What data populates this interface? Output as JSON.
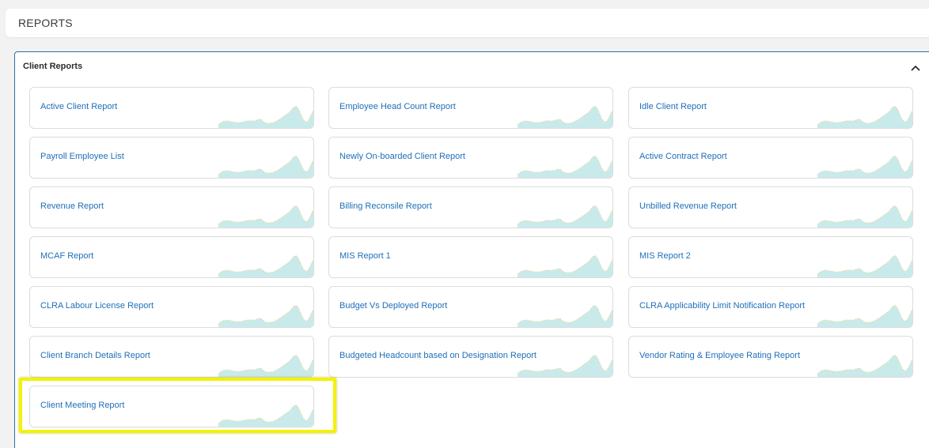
{
  "header": {
    "title": "REPORTS"
  },
  "panel": {
    "title": "Client Reports",
    "collapse_icon": "chevron-up-icon"
  },
  "reports": [
    {
      "label": "Active Client Report"
    },
    {
      "label": "Employee Head Count Report"
    },
    {
      "label": "Idle Client Report"
    },
    {
      "label": "Payroll Employee List"
    },
    {
      "label": "Newly On-boarded Client Report"
    },
    {
      "label": "Active Contract Report"
    },
    {
      "label": "Revenue Report"
    },
    {
      "label": "Billing Reconsile Report"
    },
    {
      "label": "Unbilled Revenue Report"
    },
    {
      "label": "MCAF Report"
    },
    {
      "label": "MIS Report 1"
    },
    {
      "label": "MIS Report 2"
    },
    {
      "label": "CLRA Labour License Report"
    },
    {
      "label": "Budget Vs Deployed Report"
    },
    {
      "label": "CLRA Applicability Limit Notification Report"
    },
    {
      "label": "Client Branch Details Report"
    },
    {
      "label": "Budgeted Headcount based on Designation Report"
    },
    {
      "label": "Vendor Rating & Employee Rating Report"
    },
    {
      "label": "Client Meeting Report"
    }
  ],
  "highlighted_report": "Client Meeting Report",
  "colors": {
    "link": "#1f6fb8",
    "panel_border": "#2e6da4",
    "highlight": "#f2f20a",
    "sparkline_fill": "#bfe6e6",
    "sparkline_dots": "#e8d9a0"
  }
}
